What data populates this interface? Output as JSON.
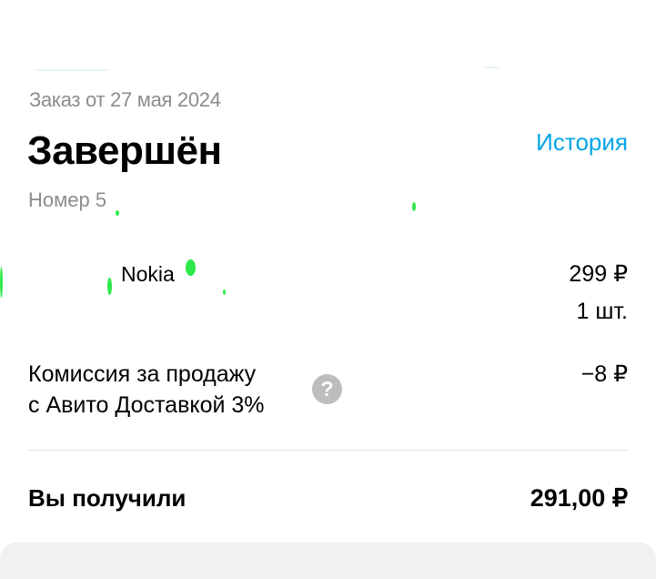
{
  "order": {
    "date_label": "Заказ от 27 мая 2024",
    "status": "Завершён",
    "history_link": "История",
    "number_label": "Номер 5"
  },
  "item": {
    "name": "Nokia",
    "price": "299 ₽",
    "quantity": "1 шт."
  },
  "commission": {
    "line1": "Комиссия за продажу",
    "line2": "с Авито Доставкой 3%",
    "value": "−8 ₽",
    "help_icon": "question-circle-icon"
  },
  "total": {
    "label": "Вы получили",
    "value": "291,00 ₽"
  },
  "colors": {
    "accent": "#00a6e6",
    "muted_text": "#8c8c8c",
    "help_icon_bg": "#bdbdbd",
    "divider": "#e6e6e6"
  }
}
